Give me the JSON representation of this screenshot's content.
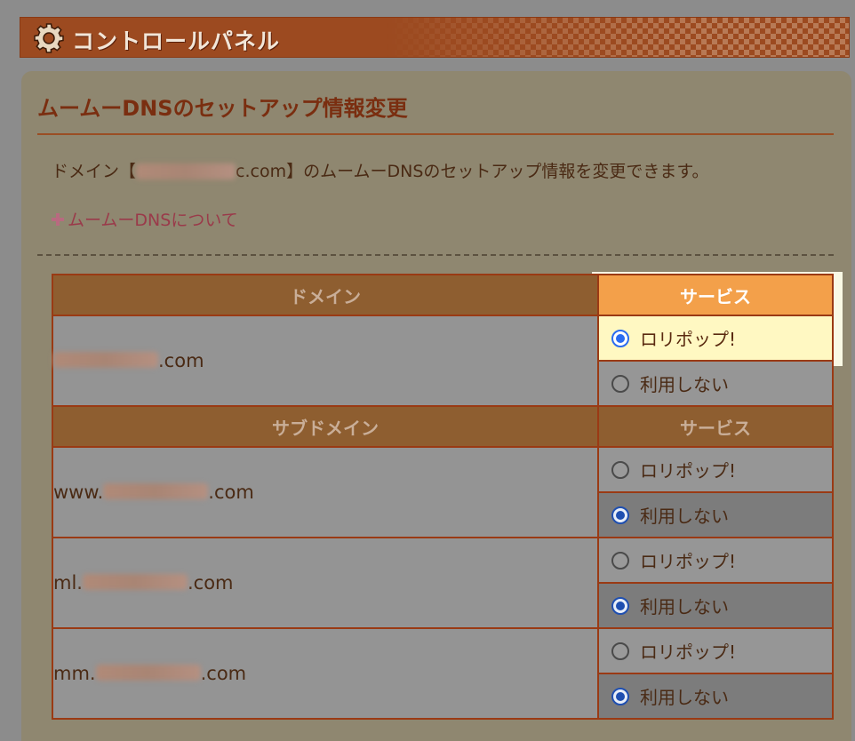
{
  "header": {
    "title": "コントロールパネル"
  },
  "panel": {
    "title": "ムームーDNSのセットアップ情報変更",
    "description_before": "ドメイン【",
    "description_domain_tail": "c.com",
    "description_after": "】のムームーDNSのセットアップ情報を変更できます。",
    "about_link": "ムームーDNSについて"
  },
  "table": {
    "domain_header": "ドメイン",
    "service_header": "サービス",
    "subdomain_header": "サブドメイン",
    "domain": {
      "suffix": ".com",
      "options": [
        {
          "label": "ロリポップ!",
          "selected": true
        },
        {
          "label": "利用しない",
          "selected": false
        }
      ]
    },
    "subdomains": [
      {
        "prefix": "www.",
        "suffix": ".com",
        "options": [
          {
            "label": "ロリポップ!",
            "selected": false
          },
          {
            "label": "利用しない",
            "selected": true
          }
        ]
      },
      {
        "prefix": "ml.",
        "suffix": ".com",
        "options": [
          {
            "label": "ロリポップ!",
            "selected": false
          },
          {
            "label": "利用しない",
            "selected": true
          }
        ]
      },
      {
        "prefix": "mm.",
        "suffix": ".com",
        "options": [
          {
            "label": "ロリポップ!",
            "selected": false
          },
          {
            "label": "利用しない",
            "selected": true
          }
        ]
      }
    ]
  },
  "colors": {
    "banner": "#9c4a20",
    "accent": "#f3a04a",
    "radio_selected": "#1f4fb0",
    "highlight": "#fff8c2"
  },
  "icons": [
    "gear-icon",
    "plus-icon",
    "radio-icon"
  ]
}
